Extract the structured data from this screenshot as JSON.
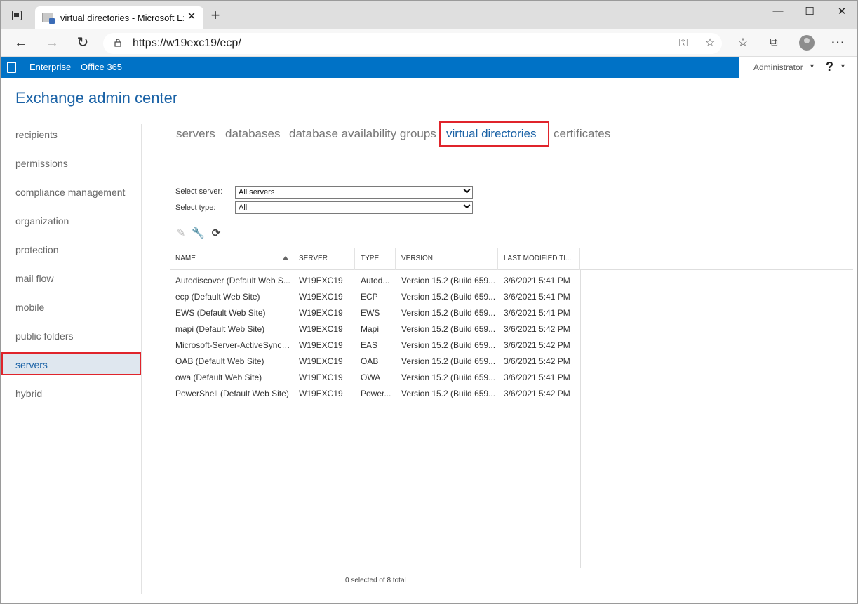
{
  "browser": {
    "tab_title": "virtual directories - Microsoft Exc",
    "url": "https://w19exc19/ecp/"
  },
  "suitebar": {
    "links": [
      "Enterprise",
      "Office 365"
    ],
    "user": "Administrator",
    "help": "?"
  },
  "eac": {
    "title": "Exchange admin center"
  },
  "leftnav": {
    "items": [
      "recipients",
      "permissions",
      "compliance management",
      "organization",
      "protection",
      "mail flow",
      "mobile",
      "public folders",
      "servers",
      "hybrid"
    ],
    "selected": "servers"
  },
  "subtabs": {
    "items": [
      "servers",
      "databases",
      "database availability groups",
      "virtual directories",
      "certificates"
    ],
    "active": "virtual directories"
  },
  "filters": {
    "server_label": "Select server:",
    "server_value": "All servers",
    "type_label": "Select type:",
    "type_value": "All"
  },
  "grid": {
    "columns": [
      "NAME",
      "SERVER",
      "TYPE",
      "VERSION",
      "LAST MODIFIED TI..."
    ],
    "rows": [
      [
        "Autodiscover (Default Web S...",
        "W19EXC19",
        "Autod...",
        "Version 15.2 (Build 659...",
        "3/6/2021 5:41 PM"
      ],
      [
        "ecp (Default Web Site)",
        "W19EXC19",
        "ECP",
        "Version 15.2 (Build 659...",
        "3/6/2021 5:41 PM"
      ],
      [
        "EWS (Default Web Site)",
        "W19EXC19",
        "EWS",
        "Version 15.2 (Build 659...",
        "3/6/2021 5:41 PM"
      ],
      [
        "mapi (Default Web Site)",
        "W19EXC19",
        "Mapi",
        "Version 15.2 (Build 659...",
        "3/6/2021 5:42 PM"
      ],
      [
        "Microsoft-Server-ActiveSync ...",
        "W19EXC19",
        "EAS",
        "Version 15.2 (Build 659...",
        "3/6/2021 5:42 PM"
      ],
      [
        "OAB (Default Web Site)",
        "W19EXC19",
        "OAB",
        "Version 15.2 (Build 659...",
        "3/6/2021 5:42 PM"
      ],
      [
        "owa (Default Web Site)",
        "W19EXC19",
        "OWA",
        "Version 15.2 (Build 659...",
        "3/6/2021 5:41 PM"
      ],
      [
        "PowerShell (Default Web Site)",
        "W19EXC19",
        "Power...",
        "Version 15.2 (Build 659...",
        "3/6/2021 5:42 PM"
      ]
    ],
    "status": "0 selected of 8 total"
  },
  "icons": {
    "edit": "pencil-icon",
    "configure": "wrench-icon",
    "refresh": "refresh-icon"
  },
  "colors": {
    "suite_blue": "#0072c6",
    "accent_blue": "#1a62a6",
    "highlight_red": "#e0242b"
  }
}
